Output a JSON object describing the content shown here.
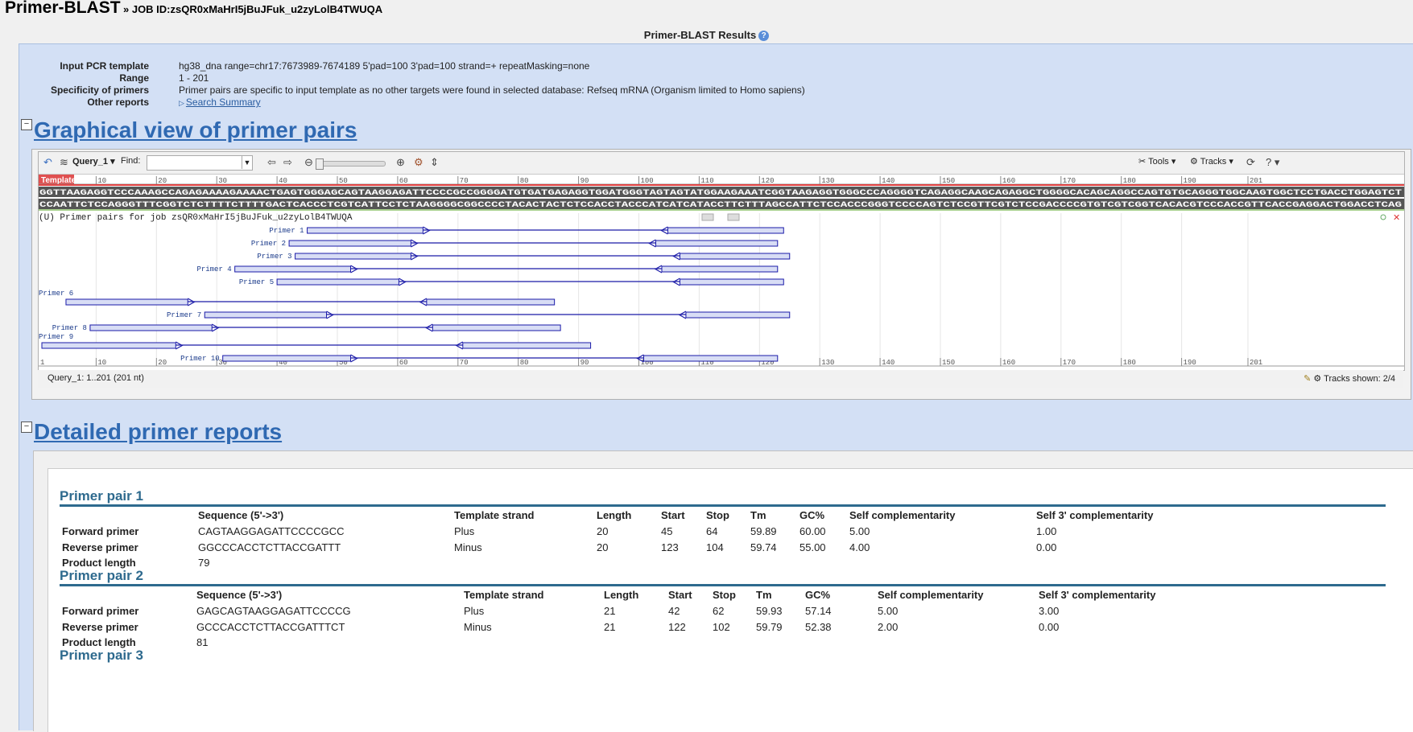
{
  "header": {
    "app_title": "Primer-BLAST",
    "job_label": "» JOB ID:zsQR0xMaHrI5jBuJFuk_u2zyLolB4TWUQA",
    "results_title": "Primer-BLAST Results",
    "help": "?"
  },
  "info": [
    {
      "label": "Input PCR template",
      "value": "hg38_dna range=chr17:7673989-7674189 5'pad=100 3'pad=100 strand=+ repeatMasking=none"
    },
    {
      "label": "Range",
      "value": "1 - 201"
    },
    {
      "label": "Specificity of primers",
      "value": "Primer pairs are specific to input template as no other targets were found in selected database: Refseq mRNA (Organism limited to Homo sapiens)"
    },
    {
      "label": "Other reports",
      "link": "Search Summary"
    }
  ],
  "sections": {
    "graphical": "Graphical view of primer pairs",
    "detailed": "Detailed primer reports",
    "toggle": "−"
  },
  "viewer": {
    "query_menu": "Query_1",
    "find_label": "Find:",
    "tools_label": "Tools",
    "tracks_label": "Tracks",
    "template_label": "Template",
    "ruler_ticks": [
      10,
      20,
      30,
      40,
      50,
      60,
      70,
      80,
      90,
      100,
      110,
      120,
      130,
      140,
      150,
      160,
      170,
      180,
      190,
      201
    ],
    "ruler_start": 1,
    "forward_seq": "GGTTAAGAGGTCCCAAAGCCAGAGAAAAGAAAACTGAGTGGGAGCAGTAAGGAGATTCCCCGCCGGGGATGTGATGAGAGGTGGATGGGTAGTAGTATGGAAGAAATCGGTAAGAGGTGGGCCCAGGGGTCAGAGGCAAGCAGAGGCTGGGGCACAGCAGGCCAGTGTGCAGGGTGGCAAGTGGCTCCTGACCTGGAGTCT",
    "reverse_seq": "CCAATTCTCCAGGGTTTCGGTCTCTTTTCTTTTGACTCACCCTCGTCATTCCTCTAAGGGGCGGCCCCTACACTACTCTCCACCTACCCATCATCATACCTTCTTTAGCCATTCTCCACCCGGGTCCCCAGTCTCCGTTCGTCTCCGACCCCGTGTCGTCGGTCACACGTCCCACCGTTCACCGAGGACTGGACCTCAG",
    "track_title": "(U) Primer pairs for job zsQR0xMaHrI5jBuJFuk_u2zyLolB4TWUQA",
    "status": "Query_1: 1..201 (201 nt)",
    "tracks_shown": "Tracks shown: 2/4"
  },
  "primer_tracks": [
    {
      "label": "Primer 1",
      "fwd": [
        45,
        64
      ],
      "rev": [
        104,
        123
      ]
    },
    {
      "label": "Primer 2",
      "fwd": [
        42,
        62
      ],
      "rev": [
        102,
        122
      ]
    },
    {
      "label": "Primer 3",
      "fwd": [
        43,
        62
      ],
      "rev": [
        106,
        124
      ]
    },
    {
      "label": "Primer 4",
      "fwd": [
        33,
        52
      ],
      "rev": [
        103,
        122
      ]
    },
    {
      "label": "Primer 5",
      "fwd": [
        40,
        60
      ],
      "rev": [
        106,
        123
      ]
    },
    {
      "label": "Primer 6",
      "fwd": [
        5,
        25
      ],
      "rev": [
        64,
        85
      ]
    },
    {
      "label": "Primer 7",
      "fwd": [
        28,
        48
      ],
      "rev": [
        107,
        124
      ]
    },
    {
      "label": "Primer 8",
      "fwd": [
        9,
        29
      ],
      "rev": [
        65,
        86
      ]
    },
    {
      "label": "Primer 9",
      "fwd": [
        1,
        23
      ],
      "rev": [
        70,
        91
      ]
    },
    {
      "label": "Primer 10",
      "fwd": [
        31,
        52
      ],
      "rev": [
        100,
        122
      ]
    }
  ],
  "headers": [
    "Sequence (5'->3')",
    "Template strand",
    "Length",
    "Start",
    "Stop",
    "Tm",
    "GC%",
    "Self complementarity",
    "Self 3' complementarity"
  ],
  "pairs": [
    {
      "title": "Primer pair 1",
      "forward": {
        "label": "Forward primer",
        "cells": [
          "CAGTAAGGAGATTCCCCGCC",
          "Plus",
          "20",
          "45",
          "64",
          "59.89",
          "60.00",
          "5.00",
          "1.00"
        ]
      },
      "reverse": {
        "label": "Reverse primer",
        "cells": [
          "GGCCCACCTCTTACCGATTT",
          "Minus",
          "20",
          "123",
          "104",
          "59.74",
          "55.00",
          "4.00",
          "0.00"
        ]
      },
      "product": {
        "label": "Product length",
        "value": "79"
      }
    },
    {
      "title": "Primer pair 2",
      "forward": {
        "label": "Forward primer",
        "cells": [
          "GAGCAGTAAGGAGATTCCCCG",
          "Plus",
          "21",
          "42",
          "62",
          "59.93",
          "57.14",
          "5.00",
          "3.00"
        ]
      },
      "reverse": {
        "label": "Reverse primer",
        "cells": [
          "GCCCACCTCTTACCGATTTCT",
          "Minus",
          "21",
          "122",
          "102",
          "59.79",
          "52.38",
          "2.00",
          "0.00"
        ]
      },
      "product": {
        "label": "Product length",
        "value": "81"
      }
    },
    {
      "title": "Primer pair 3"
    }
  ],
  "colors": {
    "panel": "#d3e0f5",
    "title_blue": "#2f69b2",
    "pair_teal": "#2e6a8e",
    "primer_blue": "#1a1aa8"
  }
}
